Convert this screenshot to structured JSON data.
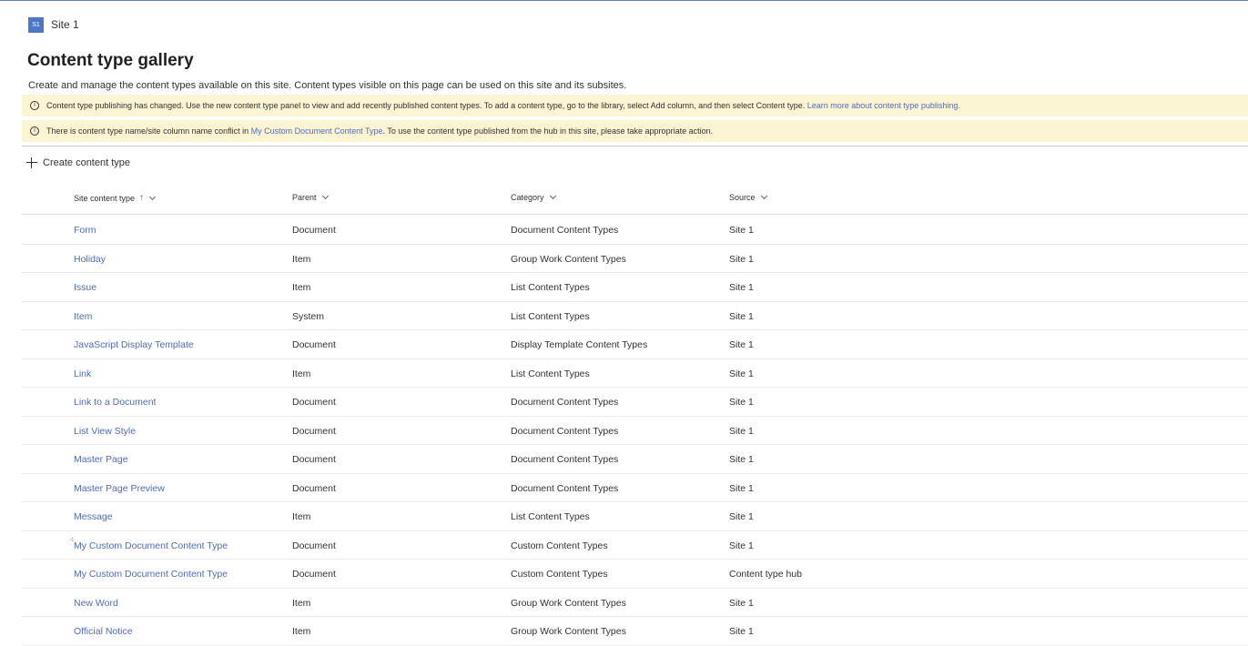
{
  "site": {
    "logo_text": "S1",
    "name": "Site 1"
  },
  "page": {
    "title": "Content type gallery",
    "description": "Create and manage the content types available on this site. Content types visible on this page can be used on this site and its subsites."
  },
  "banners": {
    "publishing": {
      "text": "Content type publishing has changed. Use the new content type panel to view and add recently published content types. To add a content type, go to the library, select Add column, and then select Content type.",
      "link": "Learn more about content type publishing."
    },
    "conflict": {
      "prefix": "There is content type name/site column name conflict in",
      "link": "My Custom Document Content Type",
      "suffix": ". To use the content type published from the hub in this site, please take appropriate action."
    }
  },
  "commands": {
    "create": "Create content type"
  },
  "table": {
    "columns": {
      "name": "Site content type",
      "parent": "Parent",
      "category": "Category",
      "source": "Source"
    },
    "rows": [
      {
        "name": "Form",
        "parent": "Document",
        "category": "Document Content Types",
        "source": "Site 1"
      },
      {
        "name": "Holiday",
        "parent": "Item",
        "category": "Group Work Content Types",
        "source": "Site 1"
      },
      {
        "name": "Issue",
        "parent": "Item",
        "category": "List Content Types",
        "source": "Site 1"
      },
      {
        "name": "Item",
        "parent": "System",
        "category": "List Content Types",
        "source": "Site 1"
      },
      {
        "name": "JavaScript Display Template",
        "parent": "Document",
        "category": "Display Template Content Types",
        "source": "Site 1"
      },
      {
        "name": "Link",
        "parent": "Item",
        "category": "List Content Types",
        "source": "Site 1"
      },
      {
        "name": "Link to a Document",
        "parent": "Document",
        "category": "Document Content Types",
        "source": "Site 1"
      },
      {
        "name": "List View Style",
        "parent": "Document",
        "category": "Document Content Types",
        "source": "Site 1"
      },
      {
        "name": "Master Page",
        "parent": "Document",
        "category": "Document Content Types",
        "source": "Site 1"
      },
      {
        "name": "Master Page Preview",
        "parent": "Document",
        "category": "Document Content Types",
        "source": "Site 1"
      },
      {
        "name": "Message",
        "parent": "Item",
        "category": "List Content Types",
        "source": "Site 1"
      },
      {
        "name": "My Custom Document Content Type",
        "parent": "Document",
        "category": "Custom Content Types",
        "source": "Site 1"
      },
      {
        "name": "My Custom Document Content Type",
        "parent": "Document",
        "category": "Custom Content Types",
        "source": "Content type hub"
      },
      {
        "name": "New Word",
        "parent": "Item",
        "category": "Group Work Content Types",
        "source": "Site 1"
      },
      {
        "name": "Official Notice",
        "parent": "Item",
        "category": "Group Work Content Types",
        "source": "Site 1"
      }
    ]
  },
  "colors": {
    "accent": "#4e77c9",
    "link": "#4f6bbd",
    "banner_bg": "#fcf5d3"
  }
}
